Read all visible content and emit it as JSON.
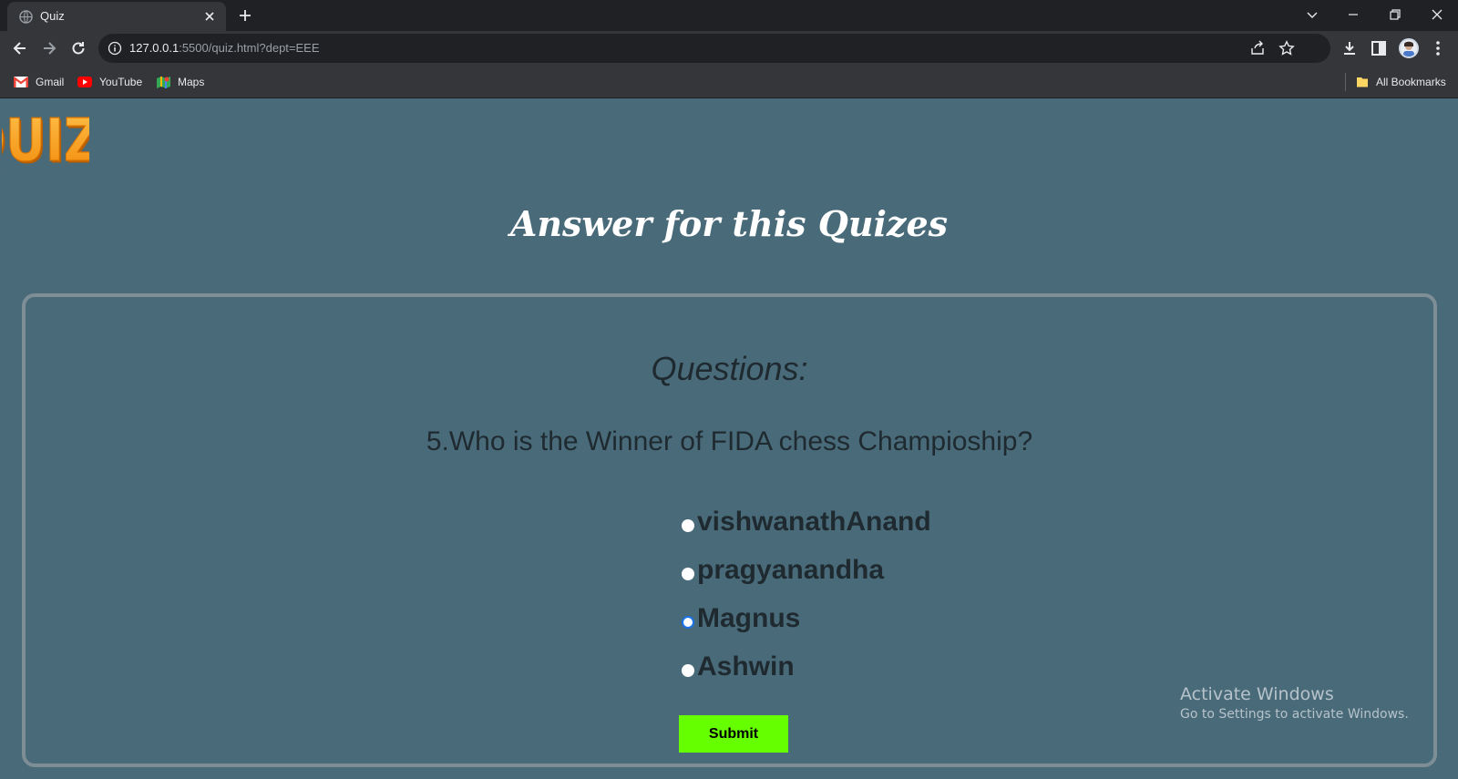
{
  "browser": {
    "tab_title": "Quiz",
    "url_host": "127.0.0.1",
    "url_path": ":5500/quiz.html?dept=EEE",
    "bookmarks": [
      "Gmail",
      "YouTube",
      "Maps"
    ],
    "all_bookmarks_label": "All Bookmarks"
  },
  "page": {
    "logo_text": "QUIZ!",
    "heading": "Answer for this Quizes",
    "questions_label": "Questions:",
    "question": "5.Who is the Winner of FIDA chess Champioship?",
    "options": [
      "vishwanathAnand",
      "pragyanandha",
      "Magnus",
      "Ashwin"
    ],
    "selected_option": "Magnus",
    "submit_label": "Submit"
  },
  "overlay": {
    "activate_title": "Activate Windows",
    "activate_sub": "Go to Settings to activate Windows."
  },
  "colors": {
    "page_bg": "#496a79",
    "submit_bg": "#66ff00",
    "card_border": "#7e8e96"
  }
}
